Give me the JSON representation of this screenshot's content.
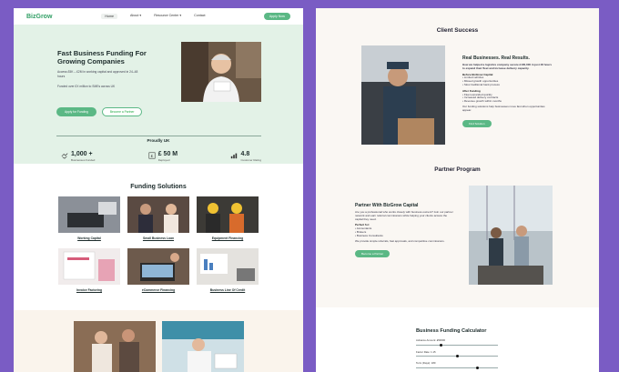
{
  "left_page": {
    "nav": {
      "logo": "BizGrow",
      "links": [
        "Home",
        "About ▾",
        "Resource Center ▾",
        "Contact"
      ],
      "apply_label": "Apply Now"
    },
    "hero": {
      "title": "Fast Business Funding For Growing Companies",
      "text1": "Access £5K – £2M in working capital and approved in 24–48 hours",
      "text2": "Funded over £X million to SMEs across UK",
      "btn_primary": "Apply for Funding",
      "btn_secondary": "Become a Partner",
      "proud": "Proudly UK",
      "stats": [
        {
          "icon": "handshake-icon",
          "value": "1,000 +",
          "label": "Businesses Funded"
        },
        {
          "icon": "pound-icon",
          "value": "£ 50 M",
          "label": "Deployed"
        },
        {
          "icon": "chart-icon",
          "value": "4.8",
          "label": "Customer Rating"
        }
      ]
    },
    "funding": {
      "title": "Funding Solutions",
      "items": [
        {
          "label": "Working Capital"
        },
        {
          "label": "Small Business Loan"
        },
        {
          "label": "Equipment Financing"
        },
        {
          "label": "Invoice Factoring"
        },
        {
          "label": "eCommerce Financing"
        },
        {
          "label": "Business Line Of Credit"
        }
      ]
    }
  },
  "right_page": {
    "client_success": {
      "title": "Client Success",
      "heading": "Real Businesses. Real Results.",
      "intro": "How we helped a logistics company secure £100,000 in just 48 hours to expand their fleet and increase delivery capacity.",
      "before_title": "Before BizGrow Capital",
      "before": [
        "• Limited vehicles",
        "• Missed growth opportunities",
        "• Slow traditional bank process"
      ],
      "after_title": "After Funding",
      "after": [
        "• Fleet expanded quickly",
        "• Increased delivery contracts",
        "• Revenue growth within months"
      ],
      "note": "Our funding solutions help businesses move fast when opportunities appear.",
      "button": "Find Solution"
    },
    "partner": {
      "title": "Partner Program",
      "heading": "Partner With BizGrow Capital",
      "text": "Are you a professional who works closely with business owners? Join our partner network and earn referral commissions while helping your clients access the capital they need.",
      "perfect_for": "Perfect for:",
      "list": [
        "• Accountants",
        "• Brokers",
        "• Business Consultants"
      ],
      "note": "We provide simple referrals, fast approvals, and competitive commissions.",
      "button": "Become a Partner"
    },
    "calculator": {
      "title": "Business Funding Calculator",
      "fields": [
        {
          "label": "Advance Amount: £50000",
          "fraction": 0.3
        },
        {
          "label": "Factor Rate: 1.15",
          "fraction": 0.5
        },
        {
          "label": "Term (Days): 180",
          "fraction": 0.75
        }
      ]
    }
  },
  "colors": {
    "accent": "#5bb885",
    "hero_bg": "#e3f2e7",
    "frame": "#7a5cc4"
  }
}
